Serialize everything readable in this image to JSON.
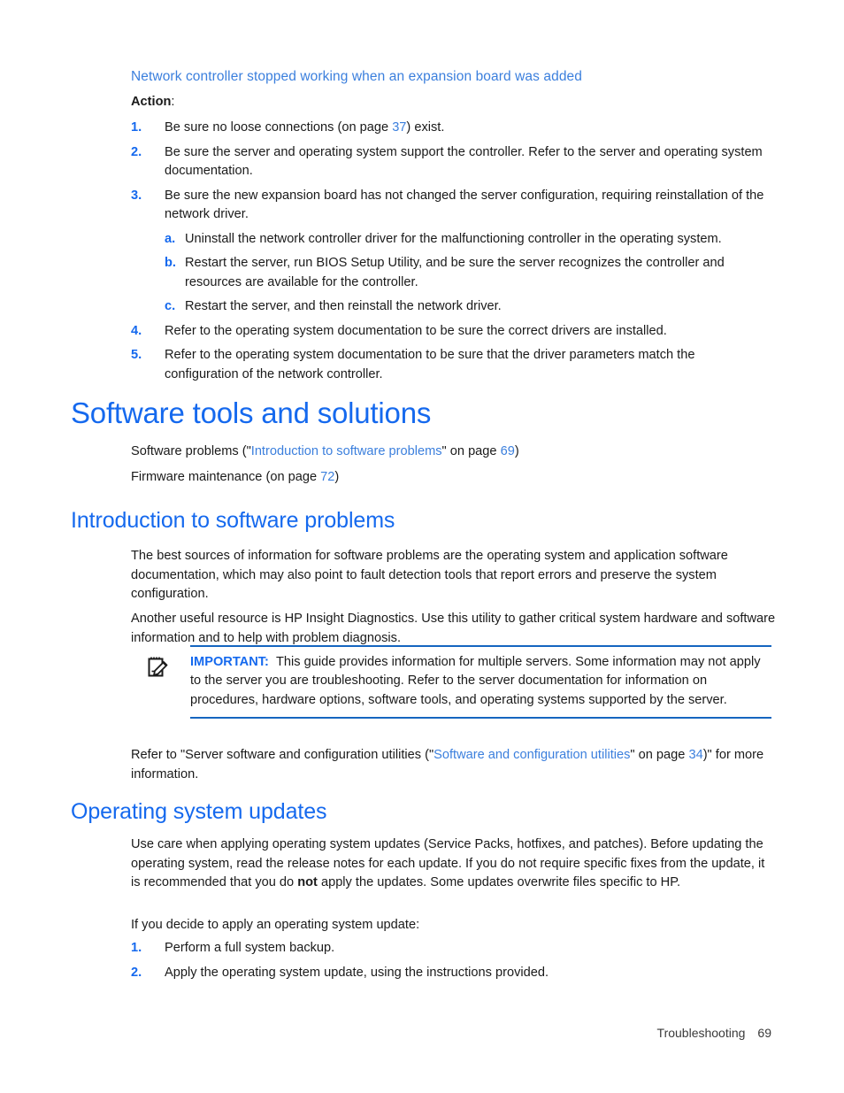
{
  "document": {
    "section_heading": "Network controller stopped working when an expansion board was added",
    "action_label": "Action",
    "action_colon": ":"
  },
  "action_steps": [
    {
      "marker": "1.",
      "text_before": "Be sure no loose connections (on page ",
      "link": "37",
      "text_after": ") exist."
    },
    {
      "marker": "2.",
      "text_before": "Be sure the server and operating system support the controller. Refer to the server and operating system documentation.",
      "link": "",
      "text_after": ""
    },
    {
      "marker": "3.",
      "text_before": "Be sure the new expansion board has not changed the server configuration, requiring reinstallation of the network driver.",
      "link": "",
      "text_after": "",
      "sub_steps": [
        {
          "marker": "a.",
          "text": "Uninstall the network controller driver for the malfunctioning controller in the operating system."
        },
        {
          "marker": "b.",
          "text": "Restart the server, run BIOS Setup Utility, and be sure the server recognizes the controller and resources are available for the controller."
        },
        {
          "marker": "c.",
          "text": "Restart the server, and then reinstall the network driver."
        }
      ]
    },
    {
      "marker": "4.",
      "text_before": "Refer to the operating system documentation to be sure the correct drivers are installed.",
      "link": "",
      "text_after": ""
    },
    {
      "marker": "5.",
      "text_before": "Refer to the operating system documentation to be sure that the driver parameters match the configuration of the network controller.",
      "link": "",
      "text_after": ""
    }
  ],
  "software_tools": {
    "heading": "Software tools and solutions",
    "line1_pre": "Software problems (\"",
    "line1_link": "Introduction to software problems",
    "line1_mid": "\" on page ",
    "line1_page": "69",
    "line1_post": ")",
    "line2_pre": "Firmware maintenance (on page ",
    "line2_page": "72",
    "line2_post": ")"
  },
  "intro_software": {
    "heading": "Introduction to software problems",
    "paragraph1": "The best sources of information for software problems are the operating system and application software documentation, which may also point to fault detection tools that report errors and preserve the system configuration.",
    "paragraph2": "Another useful resource is HP Insight Diagnostics. Use this utility to gather critical system hardware and software information and to help with problem diagnosis.",
    "note": {
      "icon": "note-pencil-icon",
      "label": "IMPORTANT:",
      "text": "This guide provides information for multiple servers. Some information may not apply to the server you are troubleshooting. Refer to the server documentation for information on procedures, hardware options, software tools, and operating systems supported by the server."
    },
    "closing_pre": "Refer to \"Server software and configuration utilities (\"",
    "closing_link": "Software and configuration utilities",
    "closing_mid": "\" on page ",
    "closing_page": "34",
    "closing_post": ")\" for more information."
  },
  "os_updates": {
    "heading": "Operating system updates",
    "paragraph_a": "Use care when applying operating system updates (Service Packs, hotfixes, and patches). Before updating the operating system, read the release notes for each update. If you do not require specific fixes from the update, it is recommended that you do ",
    "paragraph_a_bold": "not",
    "paragraph_a_end": " apply the updates. Some updates overwrite files specific to HP.",
    "paragraph_b": "If you decide to apply an operating system update:",
    "steps": [
      {
        "marker": "1.",
        "text": "Perform a full system backup."
      },
      {
        "marker": "2.",
        "text": "Apply the operating system update, using the instructions provided."
      }
    ]
  },
  "footer": {
    "chapter": "Troubleshooting",
    "page_number": "69"
  },
  "colors": {
    "heading_blue": "#1569ee",
    "subheading_blue": "#3b7fdd",
    "link_blue": "#3b7fdd",
    "rule_blue": "#1565c0",
    "body_text": "#1a1a1a"
  }
}
